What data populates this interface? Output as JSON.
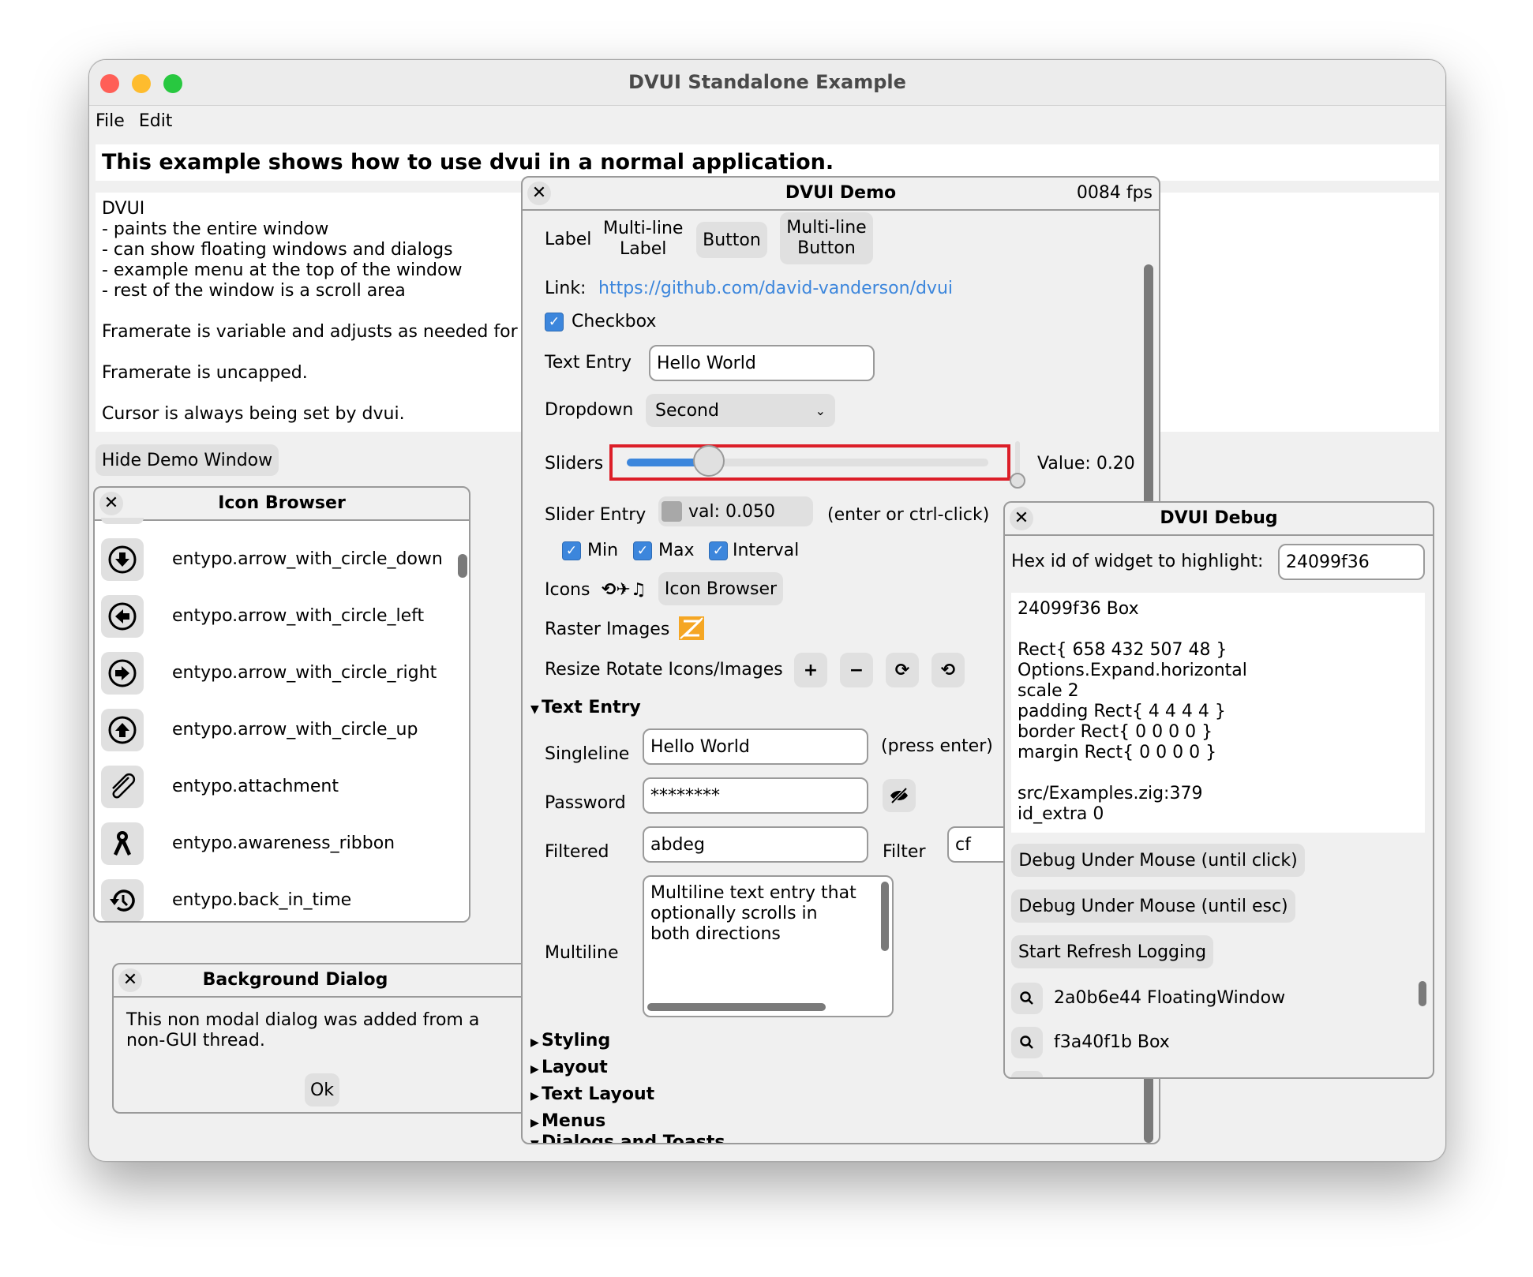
{
  "window": {
    "title": "DVUI Standalone Example",
    "traffic_lights": {
      "close": "#ff5f57",
      "minimize": "#febc2e",
      "zoom": "#28c840"
    }
  },
  "menu": {
    "items": [
      "File",
      "Edit"
    ]
  },
  "heading": "This example shows how to use dvui in a normal application.",
  "intro_text": "DVUI\n- paints the entire window\n- can show floating windows and dialogs\n- example menu at the top of the window\n- rest of the window is a scroll area\n\nFramerate is variable and adjusts as needed for\n\nFramerate is uncapped.\n\nCursor is always being set by dvui.",
  "hide_demo_button": "Hide Demo Window",
  "icon_browser": {
    "title": "Icon Browser",
    "close_icon": "close-icon",
    "items": [
      {
        "name": "entypo.arrow_with_circle_down",
        "icon": "arrow-with-circle-down-icon"
      },
      {
        "name": "entypo.arrow_with_circle_left",
        "icon": "arrow-with-circle-left-icon"
      },
      {
        "name": "entypo.arrow_with_circle_right",
        "icon": "arrow-with-circle-right-icon"
      },
      {
        "name": "entypo.arrow_with_circle_up",
        "icon": "arrow-with-circle-up-icon"
      },
      {
        "name": "entypo.attachment",
        "icon": "attachment-icon"
      },
      {
        "name": "entypo.awareness_ribbon",
        "icon": "awareness-ribbon-icon"
      },
      {
        "name": "entypo.back_in_time",
        "icon": "back-in-time-icon"
      }
    ]
  },
  "background_dialog": {
    "title": "Background Dialog",
    "message": "This non modal dialog was added from a\nnon-GUI thread.",
    "ok_label": "Ok"
  },
  "demo": {
    "title": "DVUI Demo",
    "fps": "0084 fps",
    "label": "Label",
    "multiline_label": "Multi-line\nLabel",
    "button": "Button",
    "multiline_button": "Multi-line\nButton",
    "link_label": "Link:",
    "link_url": "https://github.com/david-vanderson/dvui",
    "link_color": "#3c86dc",
    "checkbox_label": "Checkbox",
    "checkbox_checked": true,
    "text_entry_label": "Text Entry",
    "text_entry_value": "Hello World",
    "dropdown_label": "Dropdown",
    "dropdown_value": "Second",
    "sliders_label": "Sliders",
    "slider_fraction": 0.2,
    "vertical_slider_fraction": 0.0,
    "slider_value_text": "Value: 0.20",
    "slider_entry_label": "Slider Entry",
    "slider_entry_value": "val: 0.050",
    "slider_entry_hint": "(enter or ctrl-click)",
    "min_label": "Min",
    "max_label": "Max",
    "interval_label": "Interval",
    "icons_label": "Icons",
    "icons_glyphs": "⟲✈♫",
    "icon_browser_button": "Icon Browser",
    "raster_label": "Raster Images",
    "resize_label": "Resize Rotate Icons/Images",
    "resize_buttons": [
      "+",
      "−",
      "⟳",
      "⟲"
    ],
    "text_entry_section": "Text Entry",
    "singleline_label": "Singleline",
    "singleline_value": "Hello World",
    "singleline_hint": "(press enter)",
    "password_label": "Password",
    "password_value": "********",
    "filtered_label": "Filtered",
    "filtered_value": "abdeg",
    "filter_label": "Filter",
    "filter_value": "cf",
    "multiline_label_text": "Multiline",
    "multiline_value": "Multiline text entry that\noptionally scrolls in\nboth directions",
    "sections_collapsed": [
      "Styling",
      "Layout",
      "Text Layout",
      "Menus"
    ],
    "section_open_partial": "Dialogs and Toasts",
    "highlight_color": "#dc1e28"
  },
  "debug": {
    "title": "DVUI Debug",
    "hex_label": "Hex id of widget to highlight:",
    "hex_value": "24099f36",
    "info": "24099f36 Box\n\nRect{ 658 432 507 48 }\nOptions.Expand.horizontal\nscale 2\npadding Rect{ 4 4 4 4 }\nborder Rect{ 0 0 0 0 }\nmargin Rect{ 0 0 0 0 }\n\nsrc/Examples.zig:379\nid_extra 0",
    "buttons": [
      "Debug Under Mouse (until click)",
      "Debug Under Mouse (until esc)",
      "Start Refresh Logging"
    ],
    "widgets": [
      "2a0b6e44 FloatingWindow",
      "f3a40f1b Box"
    ]
  }
}
